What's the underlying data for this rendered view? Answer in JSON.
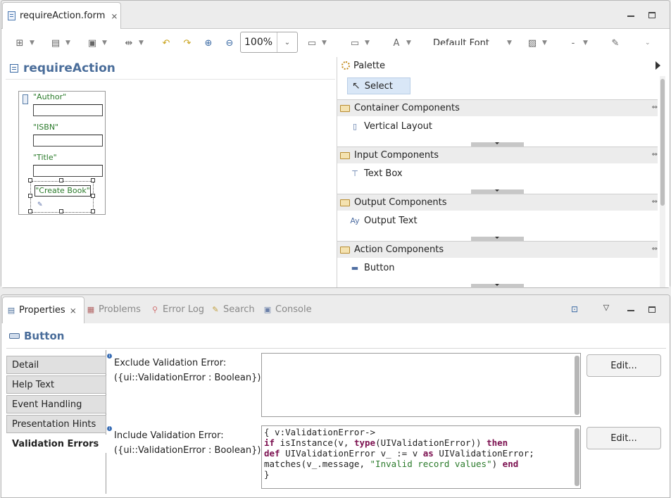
{
  "editor": {
    "tab_label": "requireAction.form",
    "tab_close": "⨯",
    "zoom_value": "100%",
    "font_value": "Default Font",
    "form_title": "requireAction",
    "fields": [
      {
        "label": "\"Author\""
      },
      {
        "label": "\"ISBN\""
      },
      {
        "label": "\"Title\""
      }
    ],
    "button_label": "\"Create Book\""
  },
  "palette": {
    "title": "Palette",
    "select_label": "Select",
    "drawers": [
      {
        "title": "Container Components",
        "item": "Vertical Layout",
        "icon": "vertical-layout-icon"
      },
      {
        "title": "Input Components",
        "item": "Text Box",
        "icon": "text-box-icon"
      },
      {
        "title": "Output Components",
        "item": "Output Text",
        "icon": "output-text-icon"
      },
      {
        "title": "Action Components",
        "item": "Button",
        "icon": "button-component-icon"
      }
    ]
  },
  "views": {
    "tabs": [
      {
        "label": "Properties",
        "icon": "properties-icon"
      },
      {
        "label": "Problems",
        "icon": "problems-icon"
      },
      {
        "label": "Error Log",
        "icon": "error-log-icon"
      },
      {
        "label": "Search",
        "icon": "search-icon"
      },
      {
        "label": "Console",
        "icon": "console-icon"
      }
    ]
  },
  "properties": {
    "title": "Button",
    "side_tabs": [
      "Detail",
      "Help Text",
      "Event Handling",
      "Presentation Hints",
      "Validation Errors"
    ],
    "active_side_tab": "Validation Errors",
    "rows": [
      {
        "label_line1": "Exclude Validation Error:",
        "label_line2": "({ui::ValidationError : Boolean})",
        "edit_label": "Edit..."
      },
      {
        "label_line1": "Include Validation Error:",
        "label_line2": "({ui::ValidationError : Boolean})",
        "edit_label": "Edit..."
      }
    ],
    "code_lines": [
      "{ v:ValidationError->",
      "if isInstance(v, type(UIValidationError)) then",
      "def UIValidationError v_ := v as UIValidationError;",
      "matches(v_.message, \"Invalid record values\") end",
      "}"
    ]
  },
  "colors": {
    "accent_title": "#4a6d9a",
    "field_label_green": "#2a7a2a",
    "keyword": "#7b0f4f",
    "selection": "#d9e7f7"
  }
}
